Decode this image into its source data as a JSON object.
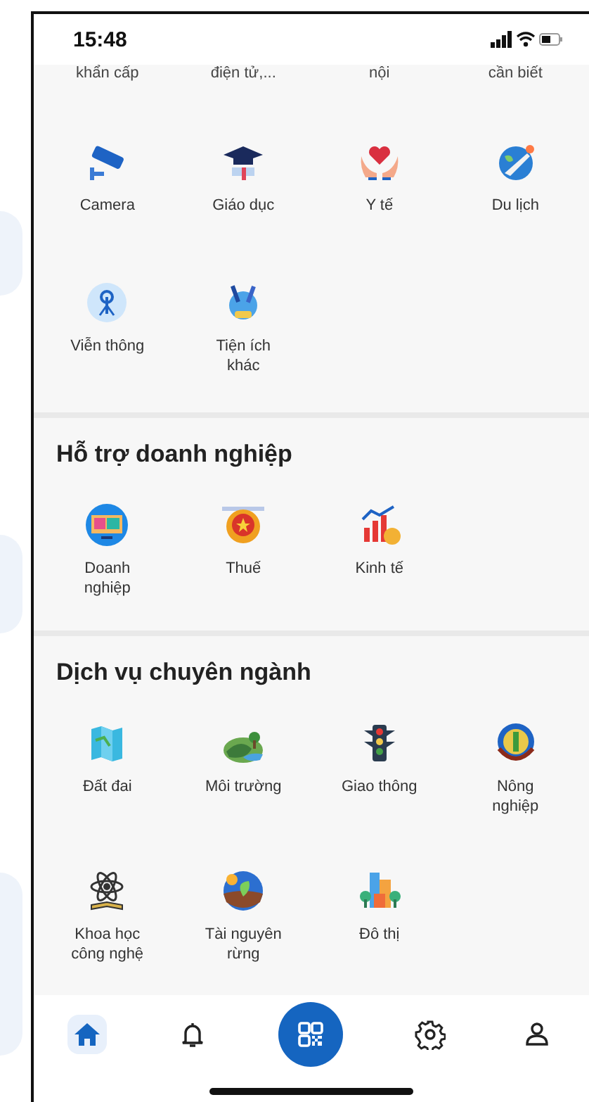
{
  "status_bar": {
    "time": "15:48"
  },
  "cut_row": [
    "khẩn cấp",
    "điện tử,...",
    "nội",
    "cần biết"
  ],
  "sections": [
    {
      "items": [
        {
          "label": "Camera"
        },
        {
          "label": "Giáo dục"
        },
        {
          "label": "Y tế"
        },
        {
          "label": "Du lịch"
        },
        {
          "label": "Viễn thông"
        },
        {
          "label": "Tiện ích khác"
        }
      ]
    },
    {
      "title": "Hỗ trợ doanh nghiệp",
      "items": [
        {
          "label": "Doanh nghiệp"
        },
        {
          "label": "Thuế"
        },
        {
          "label": "Kinh tế"
        }
      ]
    },
    {
      "title": "Dịch vụ chuyên ngành",
      "items": [
        {
          "label": "Đất đai"
        },
        {
          "label": "Môi trường"
        },
        {
          "label": "Giao thông"
        },
        {
          "label": "Nông nghiệp"
        },
        {
          "label": "Khoa học công nghệ"
        },
        {
          "label": "Tài nguyên rừng"
        },
        {
          "label": "Đô thị"
        }
      ]
    }
  ],
  "nav": [
    {
      "kind": "tab",
      "selected": true
    },
    {
      "kind": "tab",
      "selected": false
    },
    {
      "kind": "scan",
      "selected": false
    },
    {
      "kind": "tab",
      "selected": false
    },
    {
      "kind": "tab",
      "selected": false
    }
  ]
}
